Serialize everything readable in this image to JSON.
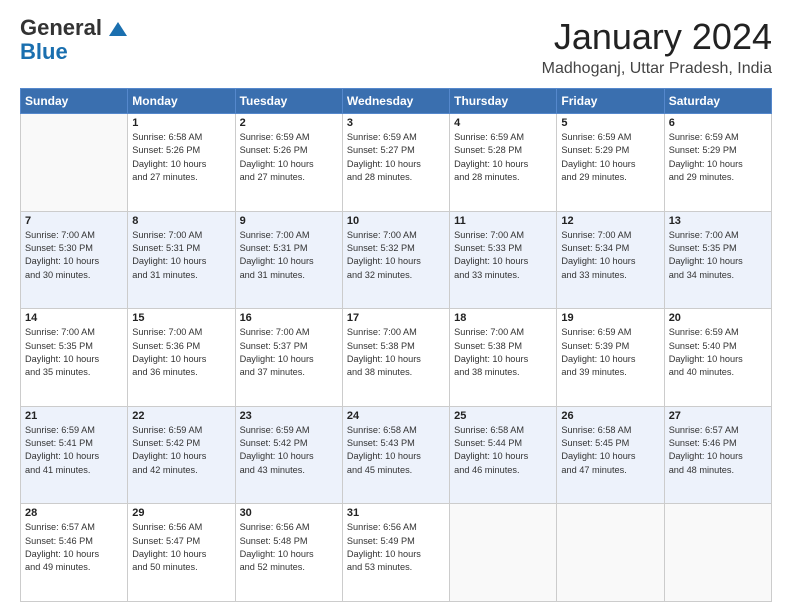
{
  "header": {
    "logo_general": "General",
    "logo_blue": "Blue",
    "title": "January 2024",
    "location": "Madhoganj, Uttar Pradesh, India"
  },
  "weekdays": [
    "Sunday",
    "Monday",
    "Tuesday",
    "Wednesday",
    "Thursday",
    "Friday",
    "Saturday"
  ],
  "weeks": [
    [
      {
        "day": "",
        "info": ""
      },
      {
        "day": "1",
        "info": "Sunrise: 6:58 AM\nSunset: 5:26 PM\nDaylight: 10 hours\nand 27 minutes."
      },
      {
        "day": "2",
        "info": "Sunrise: 6:59 AM\nSunset: 5:26 PM\nDaylight: 10 hours\nand 27 minutes."
      },
      {
        "day": "3",
        "info": "Sunrise: 6:59 AM\nSunset: 5:27 PM\nDaylight: 10 hours\nand 28 minutes."
      },
      {
        "day": "4",
        "info": "Sunrise: 6:59 AM\nSunset: 5:28 PM\nDaylight: 10 hours\nand 28 minutes."
      },
      {
        "day": "5",
        "info": "Sunrise: 6:59 AM\nSunset: 5:29 PM\nDaylight: 10 hours\nand 29 minutes."
      },
      {
        "day": "6",
        "info": "Sunrise: 6:59 AM\nSunset: 5:29 PM\nDaylight: 10 hours\nand 29 minutes."
      }
    ],
    [
      {
        "day": "7",
        "info": "Sunrise: 7:00 AM\nSunset: 5:30 PM\nDaylight: 10 hours\nand 30 minutes."
      },
      {
        "day": "8",
        "info": "Sunrise: 7:00 AM\nSunset: 5:31 PM\nDaylight: 10 hours\nand 31 minutes."
      },
      {
        "day": "9",
        "info": "Sunrise: 7:00 AM\nSunset: 5:31 PM\nDaylight: 10 hours\nand 31 minutes."
      },
      {
        "day": "10",
        "info": "Sunrise: 7:00 AM\nSunset: 5:32 PM\nDaylight: 10 hours\nand 32 minutes."
      },
      {
        "day": "11",
        "info": "Sunrise: 7:00 AM\nSunset: 5:33 PM\nDaylight: 10 hours\nand 33 minutes."
      },
      {
        "day": "12",
        "info": "Sunrise: 7:00 AM\nSunset: 5:34 PM\nDaylight: 10 hours\nand 33 minutes."
      },
      {
        "day": "13",
        "info": "Sunrise: 7:00 AM\nSunset: 5:35 PM\nDaylight: 10 hours\nand 34 minutes."
      }
    ],
    [
      {
        "day": "14",
        "info": "Sunrise: 7:00 AM\nSunset: 5:35 PM\nDaylight: 10 hours\nand 35 minutes."
      },
      {
        "day": "15",
        "info": "Sunrise: 7:00 AM\nSunset: 5:36 PM\nDaylight: 10 hours\nand 36 minutes."
      },
      {
        "day": "16",
        "info": "Sunrise: 7:00 AM\nSunset: 5:37 PM\nDaylight: 10 hours\nand 37 minutes."
      },
      {
        "day": "17",
        "info": "Sunrise: 7:00 AM\nSunset: 5:38 PM\nDaylight: 10 hours\nand 38 minutes."
      },
      {
        "day": "18",
        "info": "Sunrise: 7:00 AM\nSunset: 5:38 PM\nDaylight: 10 hours\nand 38 minutes."
      },
      {
        "day": "19",
        "info": "Sunrise: 6:59 AM\nSunset: 5:39 PM\nDaylight: 10 hours\nand 39 minutes."
      },
      {
        "day": "20",
        "info": "Sunrise: 6:59 AM\nSunset: 5:40 PM\nDaylight: 10 hours\nand 40 minutes."
      }
    ],
    [
      {
        "day": "21",
        "info": "Sunrise: 6:59 AM\nSunset: 5:41 PM\nDaylight: 10 hours\nand 41 minutes."
      },
      {
        "day": "22",
        "info": "Sunrise: 6:59 AM\nSunset: 5:42 PM\nDaylight: 10 hours\nand 42 minutes."
      },
      {
        "day": "23",
        "info": "Sunrise: 6:59 AM\nSunset: 5:42 PM\nDaylight: 10 hours\nand 43 minutes."
      },
      {
        "day": "24",
        "info": "Sunrise: 6:58 AM\nSunset: 5:43 PM\nDaylight: 10 hours\nand 45 minutes."
      },
      {
        "day": "25",
        "info": "Sunrise: 6:58 AM\nSunset: 5:44 PM\nDaylight: 10 hours\nand 46 minutes."
      },
      {
        "day": "26",
        "info": "Sunrise: 6:58 AM\nSunset: 5:45 PM\nDaylight: 10 hours\nand 47 minutes."
      },
      {
        "day": "27",
        "info": "Sunrise: 6:57 AM\nSunset: 5:46 PM\nDaylight: 10 hours\nand 48 minutes."
      }
    ],
    [
      {
        "day": "28",
        "info": "Sunrise: 6:57 AM\nSunset: 5:46 PM\nDaylight: 10 hours\nand 49 minutes."
      },
      {
        "day": "29",
        "info": "Sunrise: 6:56 AM\nSunset: 5:47 PM\nDaylight: 10 hours\nand 50 minutes."
      },
      {
        "day": "30",
        "info": "Sunrise: 6:56 AM\nSunset: 5:48 PM\nDaylight: 10 hours\nand 52 minutes."
      },
      {
        "day": "31",
        "info": "Sunrise: 6:56 AM\nSunset: 5:49 PM\nDaylight: 10 hours\nand 53 minutes."
      },
      {
        "day": "",
        "info": ""
      },
      {
        "day": "",
        "info": ""
      },
      {
        "day": "",
        "info": ""
      }
    ]
  ]
}
